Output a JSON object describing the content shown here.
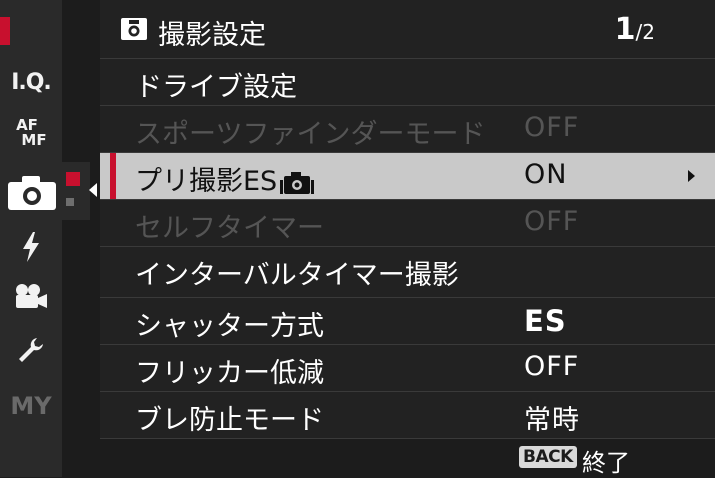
{
  "sidebar": {
    "items": [
      {
        "name": "iq",
        "label": "I.Q."
      },
      {
        "name": "af",
        "label_top": "AF",
        "label_bottom": "MF"
      },
      {
        "name": "shooting",
        "icon": "camera-icon"
      },
      {
        "name": "flash",
        "icon": "flash-icon"
      },
      {
        "name": "movie",
        "icon": "movie-camera-icon"
      },
      {
        "name": "setup",
        "icon": "wrench-icon"
      },
      {
        "name": "my",
        "label": "MY"
      }
    ]
  },
  "header": {
    "title": "撮影設定",
    "page_current": "1",
    "page_total": "/2"
  },
  "menu": {
    "items": [
      {
        "label": "ドライブ設定",
        "value": ""
      },
      {
        "label": "スポーツファインダーモード",
        "value": "OFF"
      },
      {
        "label": "プリ撮影ES",
        "value": "ON"
      },
      {
        "label": "セルフタイマー",
        "value": "OFF"
      },
      {
        "label": "インターバルタイマー撮影",
        "value": ""
      },
      {
        "label": "シャッター方式",
        "value": "ES"
      },
      {
        "label": "フリッカー低減",
        "value": "OFF"
      },
      {
        "label": "ブレ防止モード",
        "value": "常時"
      }
    ]
  },
  "footer": {
    "back_label": "BACK",
    "exit_label": "終了"
  },
  "colors": {
    "accent": "#c8102e",
    "selected_row": "#c9c9c9",
    "disabled_text": "#555555"
  }
}
